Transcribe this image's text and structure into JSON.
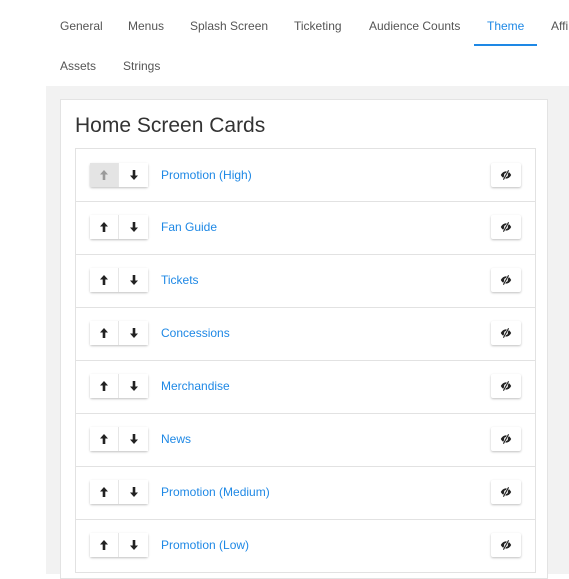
{
  "tabs": [
    {
      "label": "General",
      "active": false
    },
    {
      "label": "Menus",
      "active": false
    },
    {
      "label": "Splash Screen",
      "active": false
    },
    {
      "label": "Ticketing",
      "active": false
    },
    {
      "label": "Audience Counts",
      "active": false
    },
    {
      "label": "Theme",
      "active": true
    },
    {
      "label": "Affi",
      "active": false
    },
    {
      "label": "Assets",
      "active": false
    },
    {
      "label": "Strings",
      "active": false
    }
  ],
  "panel": {
    "title": "Home Screen Cards"
  },
  "cards": [
    {
      "label": "Promotion (High)",
      "up_disabled": true
    },
    {
      "label": "Fan Guide",
      "up_disabled": false
    },
    {
      "label": "Tickets",
      "up_disabled": false
    },
    {
      "label": "Concessions",
      "up_disabled": false
    },
    {
      "label": "Merchandise",
      "up_disabled": false
    },
    {
      "label": "News",
      "up_disabled": false
    },
    {
      "label": "Promotion (Medium)",
      "up_disabled": false
    },
    {
      "label": "Promotion (Low)",
      "up_disabled": false
    }
  ],
  "icons": {
    "move_up": "arrow-up-icon",
    "move_down": "arrow-down-icon",
    "visibility": "eye-slash-icon"
  },
  "colors": {
    "accent": "#1e88e5",
    "disabled_button": "#e4e4e4",
    "canvas": "#f2f2f2"
  }
}
